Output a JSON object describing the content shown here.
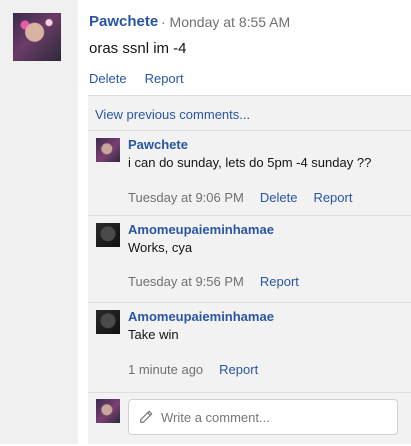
{
  "post": {
    "author": "Pawchete",
    "meta": "· Monday at 8:55 AM",
    "text": "oras ssnl im -4",
    "actions": {
      "delete": "Delete",
      "report": "Report"
    }
  },
  "comments": {
    "view_previous": "View previous comments...",
    "items": [
      {
        "author": "Pawchete",
        "text": "i can do sunday, lets do 5pm -4 sunday ??",
        "time": "Tuesday at 9:06 PM",
        "delete": "Delete",
        "report": "Report"
      },
      {
        "author": "Amomeupaieminhamae",
        "text": "Works, cya",
        "time": "Tuesday at 9:56 PM",
        "report": "Report"
      },
      {
        "author": "Amomeupaieminhamae",
        "text": "Take win",
        "time": "1 minute ago",
        "report": "Report"
      }
    ],
    "composer": {
      "placeholder": "Write a comment..."
    }
  }
}
